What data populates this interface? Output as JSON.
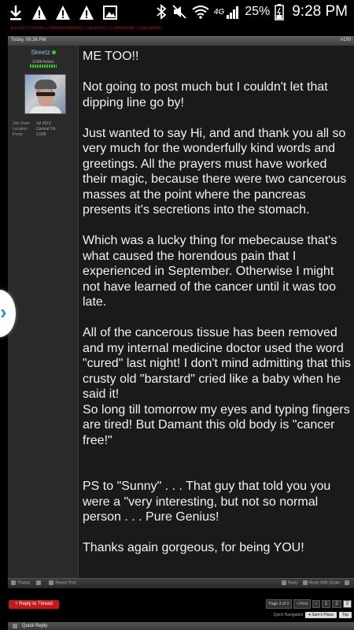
{
  "status_bar": {
    "battery_percent": "25%",
    "network": "4G",
    "time": "9:28 PM",
    "left_icons": [
      "download-icon",
      "warning-icon",
      "warning-icon",
      "warning-icon",
      "gallery-icon"
    ],
    "right_icons": [
      "bluetooth-icon",
      "mute-icon",
      "wifi-icon",
      "signal-icon",
      "battery-icon"
    ]
  },
  "header_link_text": "EX100 | Forums | Announcements | Sponsors | Community | Classifieds",
  "post": {
    "date": "Today, 06:36 PM",
    "number": "#150",
    "user": {
      "name": "Skeetz",
      "title": "EX88 Addict",
      "stats": [
        {
          "label": "Join Date:",
          "value": "Jul 2012"
        },
        {
          "label": "Location:",
          "value": "Central CA"
        },
        {
          "label": "Posts:",
          "value": "2,006"
        }
      ]
    },
    "paragraphs": [
      "ME TOO!!",
      "Not going to post much but I couldn't let that dipping line go by!",
      "Just wanted to say Hi, and and thank you all so very much for the wonderfully kind words and greetings. All the prayers must have worked their magic, because there were two cancerous masses at the point where the pancreas presents it's secretions into the stomach.",
      "Which was a lucky thing for mebecause that's what caused the horendous pain that I experienced in September. Otherwise I might not have learned of the cancer until it was too late.",
      "All of the cancerous tissue has been removed and my internal medicine doctor used the word \"cured\" last night! I don't mind admitting that this crusty old \"barstard\" cried like a baby when he said it!",
      "So long till tomorrow my eyes and typing fingers are tired! But Damant this old body is \"cancer free!\"",
      "PS to \"Sunny\" . . . That guy that told you you were a \"very interesting, but not so normal person . . . Pure Genius!",
      "Thanks again gorgeous, for being YOU!"
    ],
    "footer": {
      "thanks": "Thanks",
      "report": "Report Post",
      "reply": "Reply",
      "reply_quote": "Reply With Quote"
    }
  },
  "reply_to_thread": "+ Reply to Thread",
  "pagination": {
    "label": "Page 3 of 3",
    "first": "« First",
    "pages": [
      "‹",
      "1",
      "2",
      "3"
    ],
    "current": "3"
  },
  "quick_navigation": {
    "label": "Quick Navigation",
    "forum": "▾ Sam's Place",
    "top": "Top"
  },
  "quick_reply": "Quick Reply",
  "side_button": "›"
}
